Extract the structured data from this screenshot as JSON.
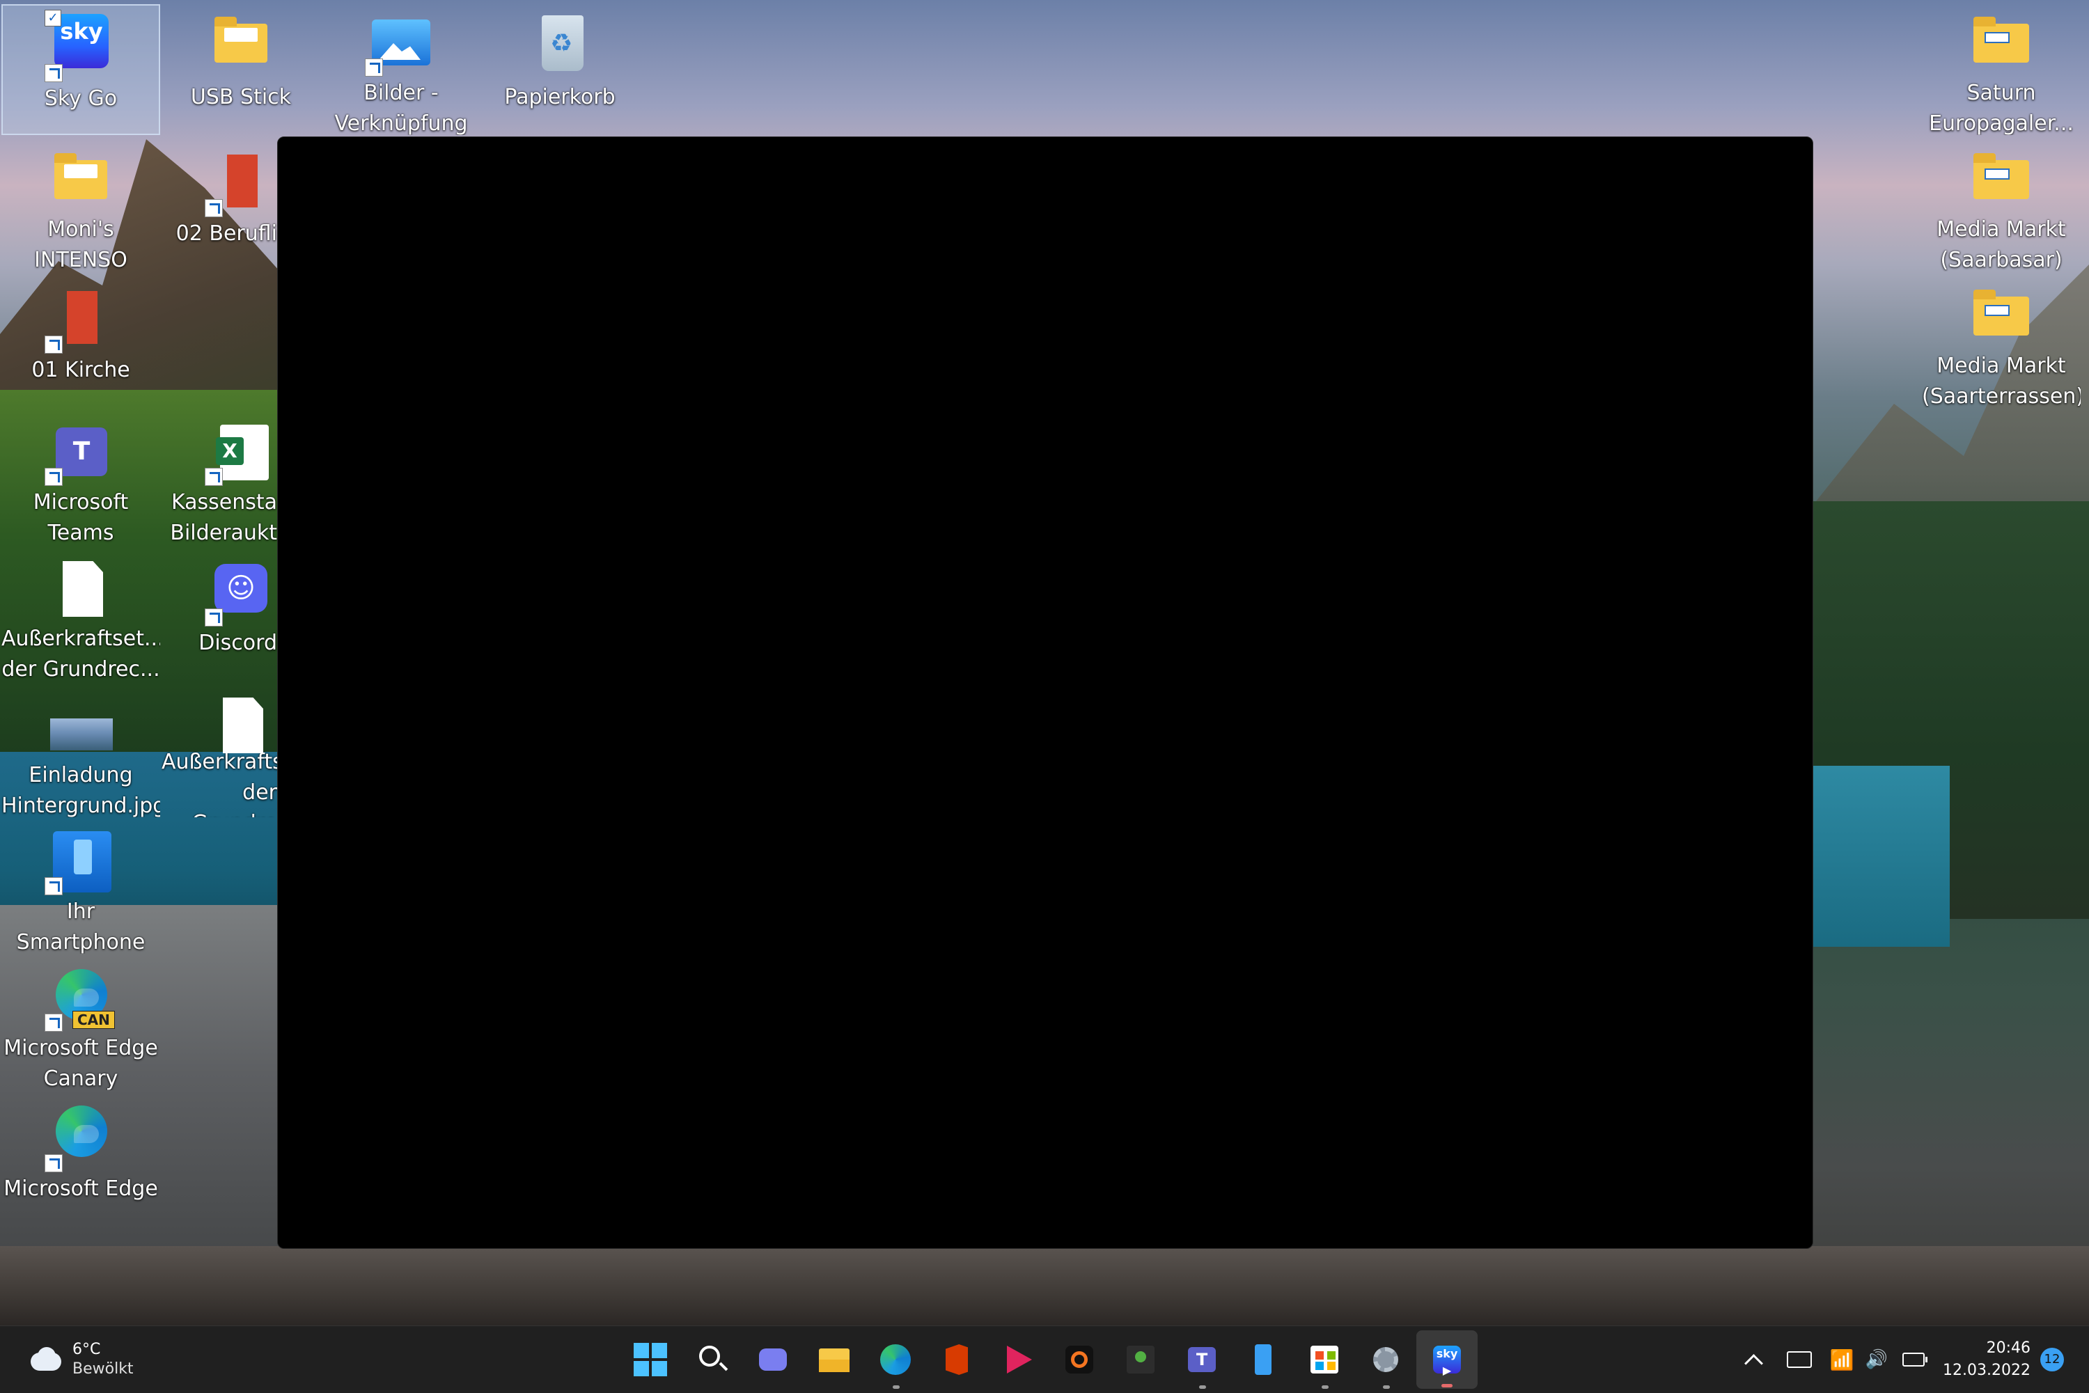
{
  "desktop": {
    "icons": [
      {
        "label": "Sky Go",
        "icon": "sky-go-icon",
        "selected": true
      },
      {
        "label": "USB Stick",
        "icon": "folder-icon"
      },
      {
        "label": "Bilder -\nVerknüpfung",
        "icon": "photos-icon"
      },
      {
        "label": "Papierkorb",
        "icon": "recycle-bin-icon"
      },
      {
        "label": "Moni's\nINTENSO",
        "icon": "folder-icon"
      },
      {
        "label": "02 Berufli",
        "icon": "red-book-icon"
      },
      {
        "label": "01 Kirche",
        "icon": "red-book-icon"
      },
      {
        "label": "Microsoft\nTeams",
        "icon": "teams-icon"
      },
      {
        "label": "Kassensta\nBilderaukt",
        "icon": "excel-icon"
      },
      {
        "label": "Außerkraftset...\nder Grundrec...",
        "icon": "document-icon"
      },
      {
        "label": "Discord",
        "icon": "discord-icon"
      },
      {
        "label": "Einladung\nHintergrund.jpg",
        "icon": "image-icon"
      },
      {
        "label": "Außerkrafts\nder Grundre",
        "icon": "document-icon"
      },
      {
        "label": "Ihr Smartphone",
        "icon": "phone-link-icon"
      },
      {
        "label": "Microsoft Edge\nCanary",
        "icon": "edge-canary-icon",
        "badge": "CAN"
      },
      {
        "label": "Microsoft Edge",
        "icon": "edge-icon"
      },
      {
        "label": "Saturn\nEuropagaler...",
        "icon": "shop-folder-icon"
      },
      {
        "label": "Media Markt\n(Saarbasar)",
        "icon": "shop-folder-icon"
      },
      {
        "label": "Media Markt\n(Saarterrassen)",
        "icon": "shop-folder-icon"
      }
    ]
  },
  "taskbar": {
    "weather": {
      "temp": "6°C",
      "condition": "Bewölkt",
      "icon": "cloud-icon"
    },
    "apps": [
      {
        "name": "start",
        "icon": "windows-start-icon"
      },
      {
        "name": "search",
        "icon": "search-icon"
      },
      {
        "name": "chat",
        "icon": "teams-chat-icon"
      },
      {
        "name": "file-explorer",
        "icon": "file-explorer-icon"
      },
      {
        "name": "edge",
        "icon": "edge-icon",
        "running": true
      },
      {
        "name": "office",
        "icon": "office-icon"
      },
      {
        "name": "media-player",
        "icon": "media-play-icon"
      },
      {
        "name": "crunchyroll",
        "icon": "crunchyroll-icon"
      },
      {
        "name": "xbox",
        "icon": "xbox-icon"
      },
      {
        "name": "teams",
        "icon": "teams-icon",
        "running": true
      },
      {
        "name": "phone-link",
        "icon": "phone-link-icon"
      },
      {
        "name": "store",
        "icon": "microsoft-store-icon",
        "running": true
      },
      {
        "name": "settings",
        "icon": "gear-icon",
        "running": true
      },
      {
        "name": "sky-go",
        "icon": "sky-go-icon",
        "active": true
      }
    ],
    "tray": {
      "time": "20:46",
      "date": "12.03.2022",
      "notifications": "12"
    }
  },
  "colors": {
    "taskbar_bg": "#202020",
    "accent": "#4cc2ff"
  }
}
